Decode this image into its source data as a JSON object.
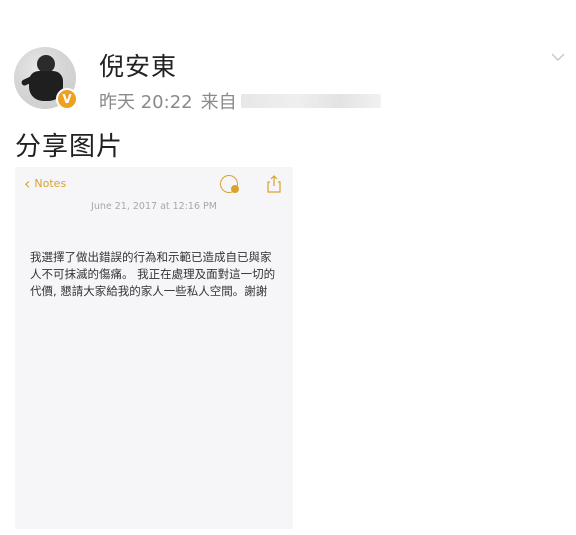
{
  "post": {
    "username": "倪安東",
    "verified_mark": "V",
    "time": "昨天 20:22",
    "source_prefix": "来自",
    "text": "分享图片"
  },
  "note": {
    "back_label": "Notes",
    "date": "June 21, 2017 at 12:16 PM",
    "body": "我選擇了做出錯誤的行為和示範已造成自已與家人不可抹滅的傷痛。 我正在處理及面對這一切的代價, 懇請大家給我的家人一些私人空間。謝謝"
  },
  "colors": {
    "note_accent": "#d9a22c",
    "verified_badge": "#f0a020",
    "meta_text": "#8a8a8a"
  },
  "icons": {
    "more": "chevron-down-icon",
    "back": "chevron-left-icon",
    "collaborate": "add-people-icon",
    "share": "share-icon"
  }
}
